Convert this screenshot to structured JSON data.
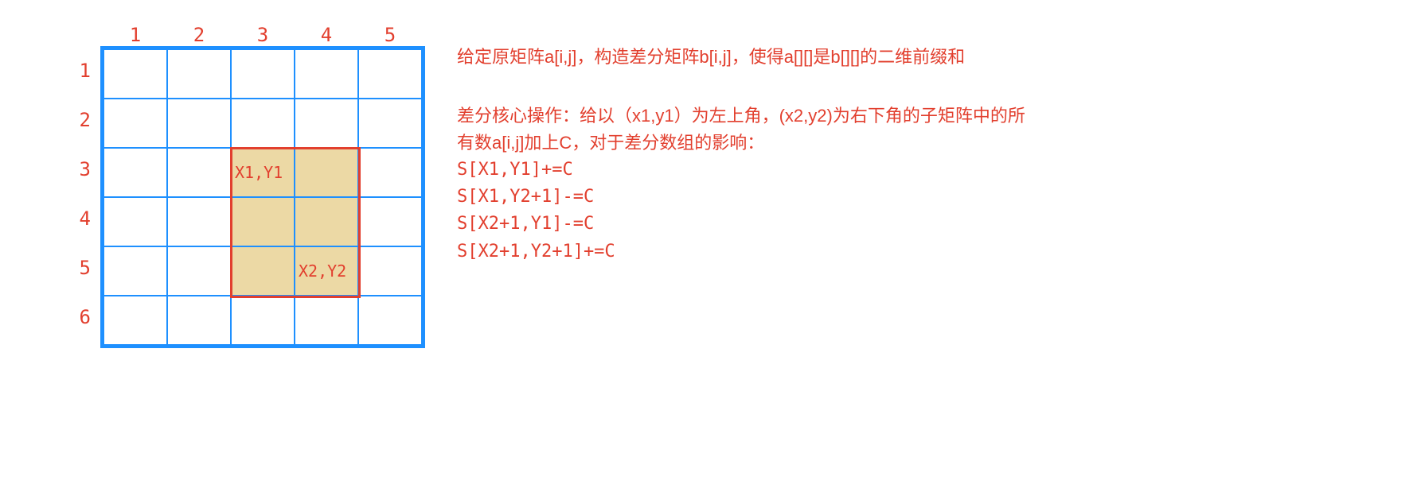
{
  "grid": {
    "cols": [
      "1",
      "2",
      "3",
      "4",
      "5"
    ],
    "rows": [
      "1",
      "2",
      "3",
      "4",
      "5",
      "6"
    ],
    "shaded": {
      "rowStart": 3,
      "rowEnd": 5,
      "colStart": 3,
      "colEnd": 4
    },
    "labelTL": "X1,Y1",
    "labelBR": "X2,Y2"
  },
  "text": {
    "intro": "给定原矩阵a[i,j]，构造差分矩阵b[i,j]，使得a[][]是b[][]的二维前缀和",
    "core1": "差分核心操作：给以（x1,y1）为左上角，(x2,y2)为右下角的子矩阵中的所",
    "core2": "有数a[i,j]加上C，对于差分数组的影响：",
    "f1": "S[X1,Y1]+=C",
    "f2": "S[X1,Y2+1]-=C",
    "f3": "S[X2+1,Y1]-=C",
    "f4": "S[X2+1,Y2+1]+=C"
  }
}
